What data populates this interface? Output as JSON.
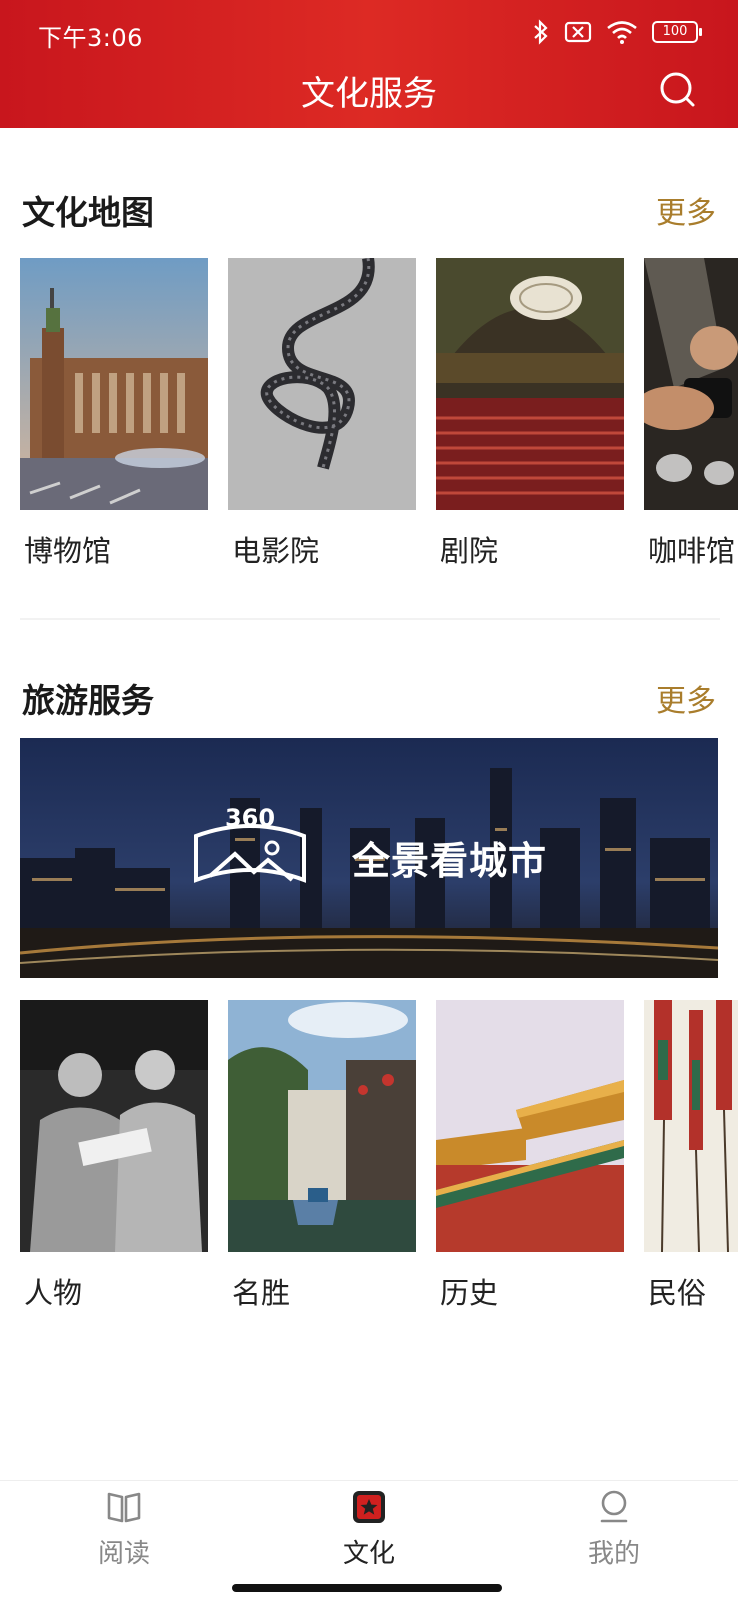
{
  "status": {
    "time": "下午3:06",
    "battery": "100"
  },
  "header": {
    "title": "文化服务"
  },
  "culture_map": {
    "title": "文化地图",
    "more": "更多",
    "items": [
      {
        "label": "博物馆"
      },
      {
        "label": "电影院"
      },
      {
        "label": "剧院"
      },
      {
        "label": "咖啡馆"
      }
    ]
  },
  "travel": {
    "title": "旅游服务",
    "more": "更多",
    "banner": {
      "text": "全景看城市",
      "badge": "360"
    },
    "items": [
      {
        "label": "人物"
      },
      {
        "label": "名胜"
      },
      {
        "label": "历史"
      },
      {
        "label": "民俗"
      }
    ]
  },
  "nav": {
    "items": [
      {
        "label": "阅读",
        "icon": "book-icon"
      },
      {
        "label": "文化",
        "icon": "star-tile-icon",
        "active": true
      },
      {
        "label": "我的",
        "icon": "person-icon"
      }
    ]
  },
  "colors": {
    "primary": "#d0201f",
    "more": "#a97d2c"
  }
}
